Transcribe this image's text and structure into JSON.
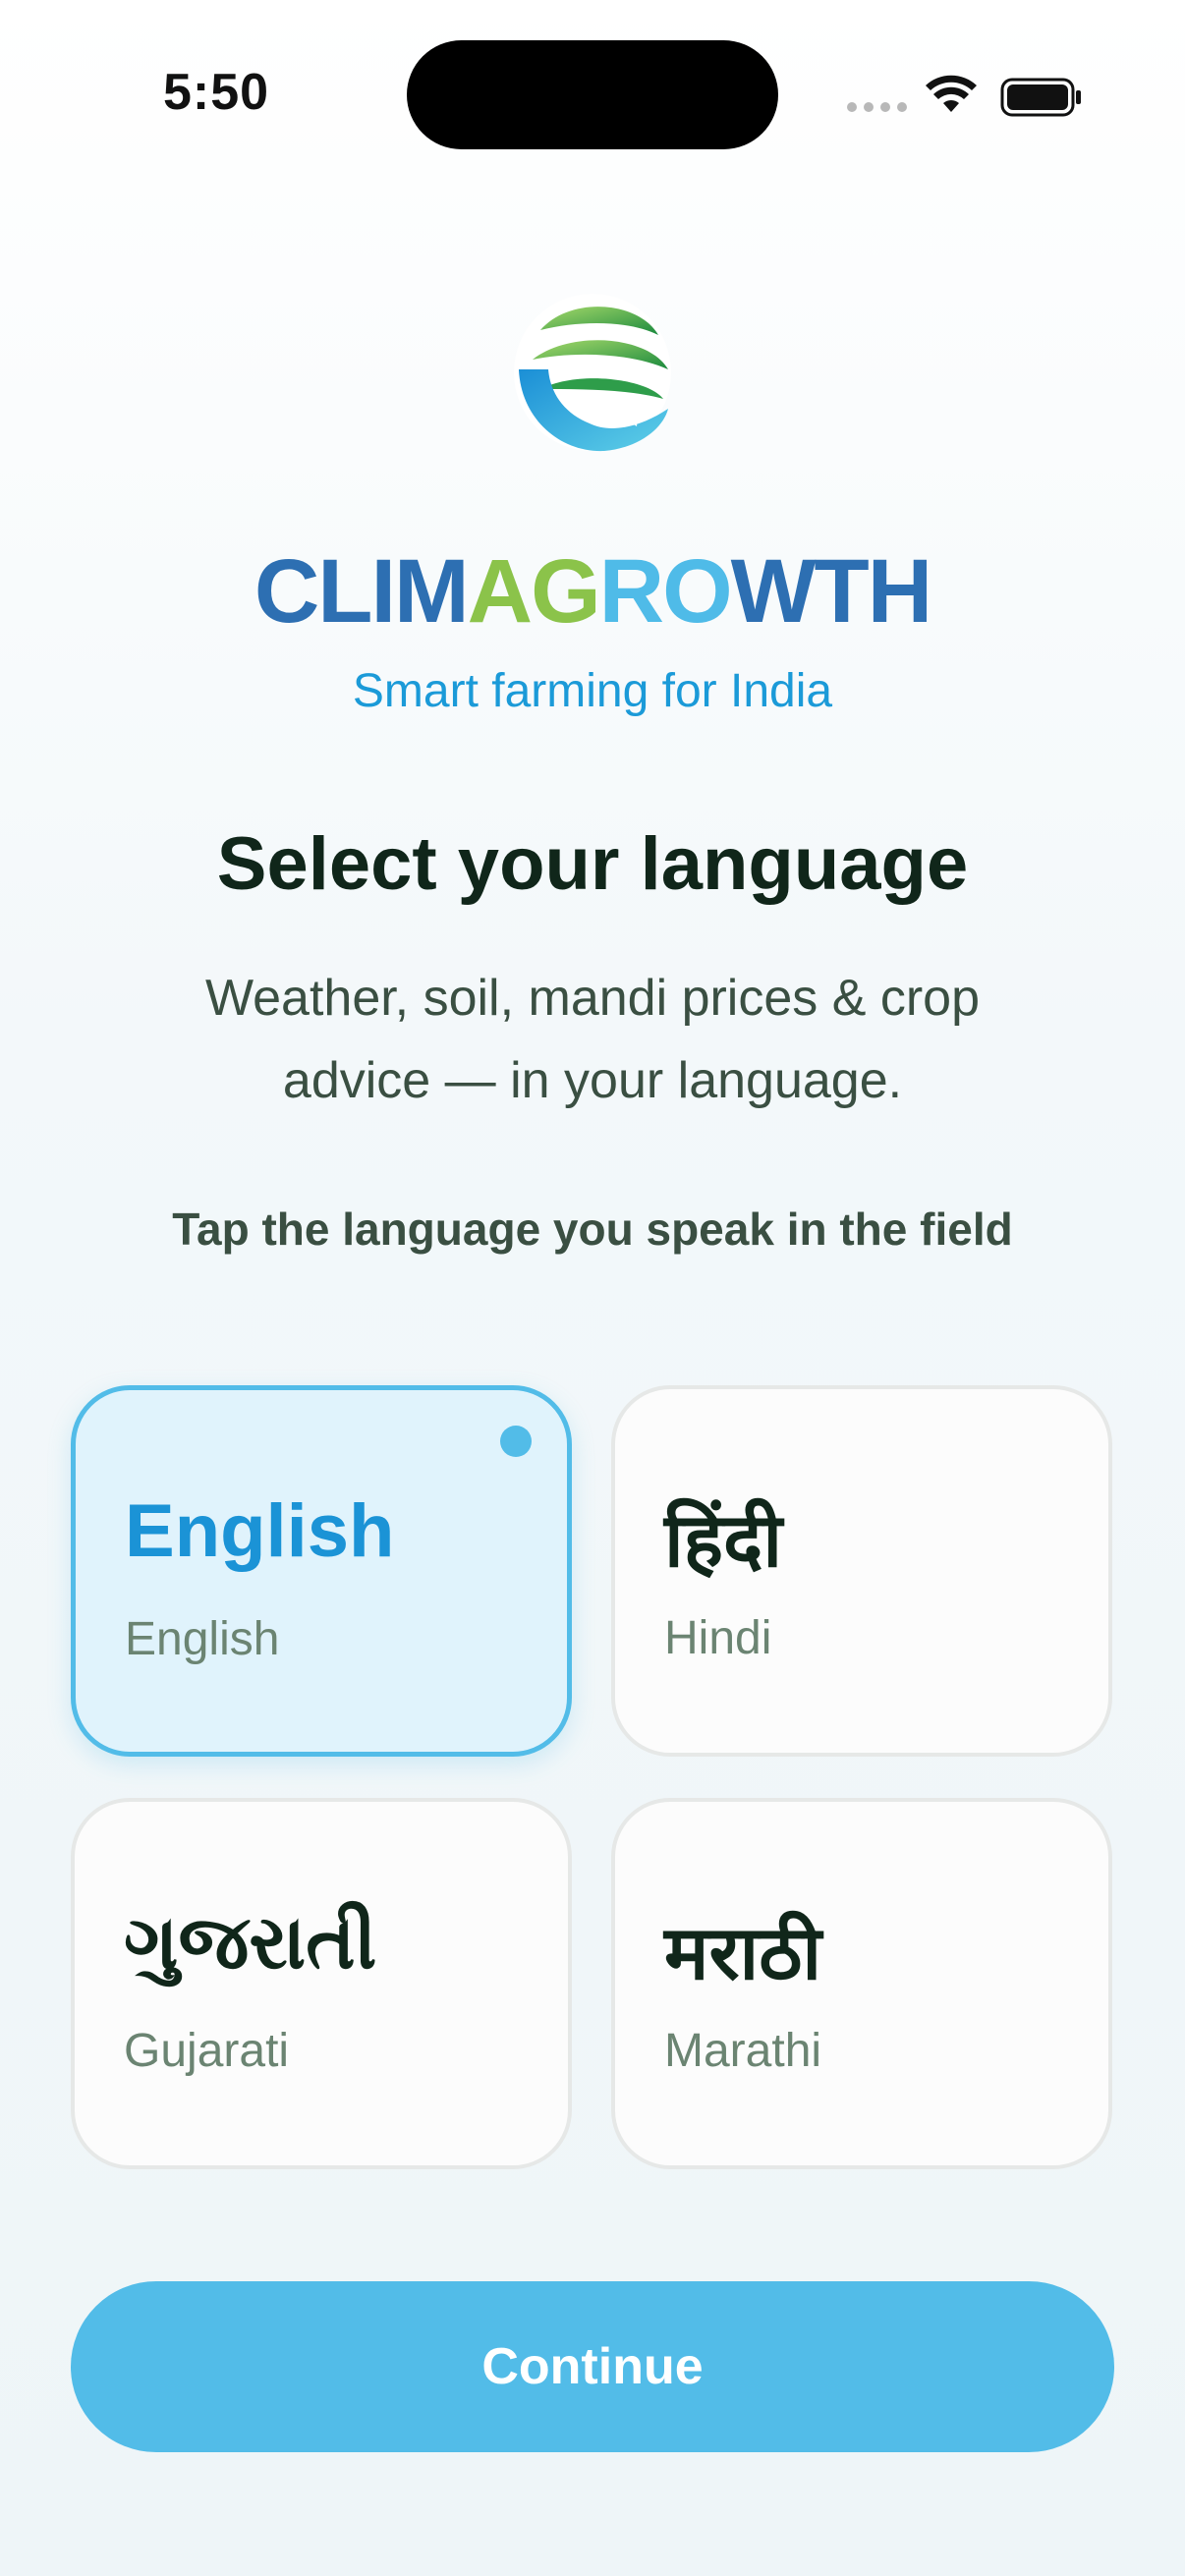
{
  "status_bar": {
    "time": "5:50"
  },
  "brand": {
    "part1": "CLIM",
    "part2": "AG",
    "part3": "RO",
    "part4": "WTH",
    "tagline": "Smart farming for India"
  },
  "heading": "Select your language",
  "subtitle": "Weather, soil, mandi prices & crop advice — in your language.",
  "hint": "Tap the language you speak in the field",
  "languages": [
    {
      "native": "English",
      "latin": "English",
      "selected": true
    },
    {
      "native": "हिंदी",
      "latin": "Hindi",
      "selected": false
    },
    {
      "native": "ગુજરાતી",
      "latin": "Gujarati",
      "selected": false
    },
    {
      "native": "मराठी",
      "latin": "Marathi",
      "selected": false
    }
  ],
  "continue_label": "Continue",
  "colors": {
    "accent": "#52bce8",
    "brand_blue": "#2d6fb2",
    "brand_green": "#8bc34a",
    "brand_light_blue": "#4fbbe8",
    "heading": "#10261a"
  },
  "icons": [
    "cellular-signal-icon",
    "wifi-icon",
    "battery-icon",
    "climagrowth-logo-icon"
  ]
}
